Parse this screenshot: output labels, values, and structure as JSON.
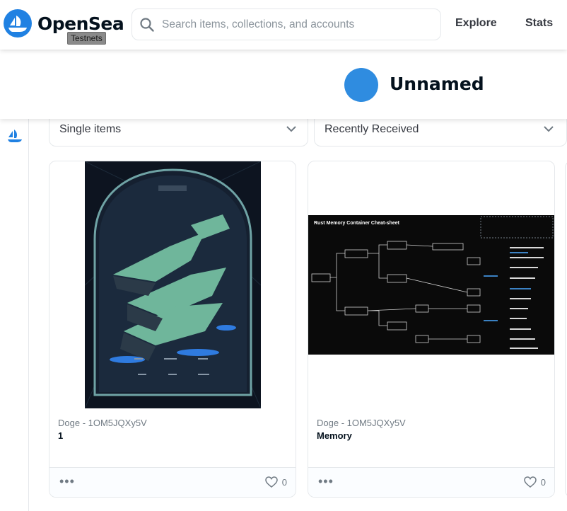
{
  "header": {
    "brand": "OpenSea",
    "badge": "Testnets",
    "search_placeholder": "Search items, collections, and accounts",
    "nav": [
      "Explore",
      "Stats"
    ]
  },
  "profile": {
    "name": "Unnamed",
    "avatar_color": "#2f8ce0"
  },
  "filters": {
    "type_select": "Single items",
    "sort_select": "Recently Received"
  },
  "cards": [
    {
      "collection": "Doge - 1OM5JQXy5V",
      "name": "1",
      "favorites": "0",
      "image": "illustration of floating green islands under a glass dome on dark background"
    },
    {
      "collection": "Doge - 1OM5JQXy5V",
      "name": "Memory",
      "favorites": "0",
      "image": "dark diagram image",
      "image_title": "Rust Memory Container Cheat-sheet"
    }
  ],
  "colors": {
    "brand_blue": "#2081e2",
    "text_dark": "#04111d",
    "text_muted": "#707a83",
    "border": "#e5e8eb"
  }
}
